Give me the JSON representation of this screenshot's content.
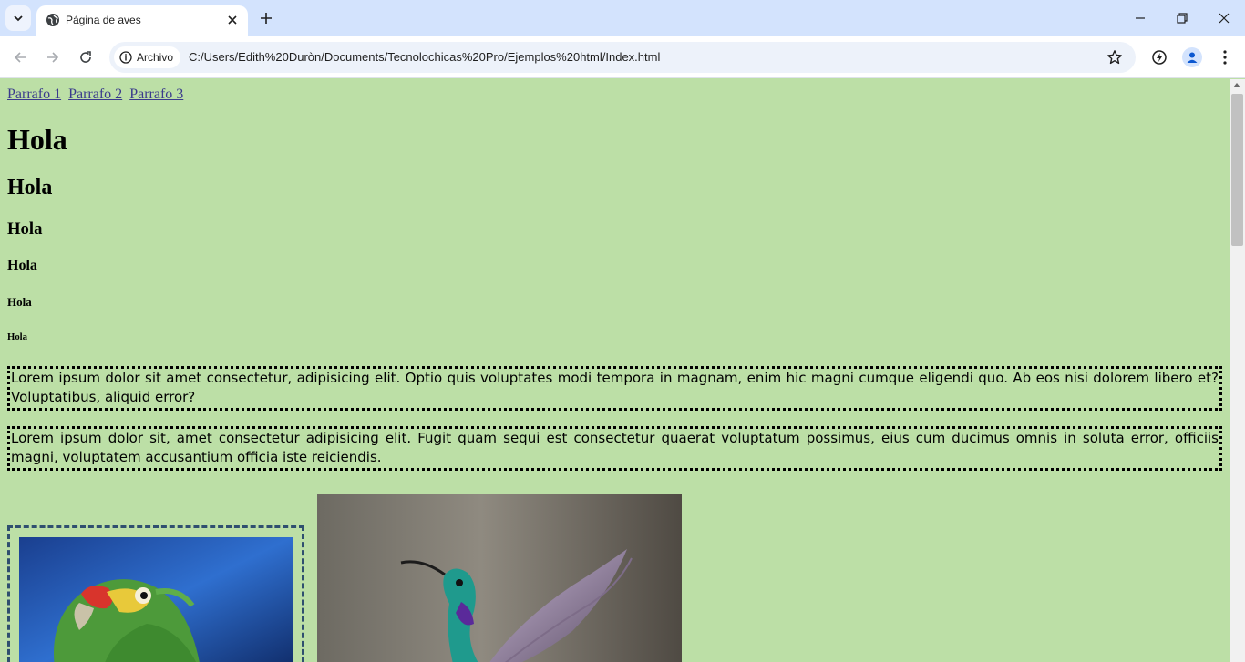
{
  "browser": {
    "tab_title": "Página de aves",
    "security_chip": "Archivo",
    "url": "C:/Users/Edith%20Duròn/Documents/Tecnolochicas%20Pro/Ejemplos%20html/Index.html"
  },
  "page": {
    "nav_links": [
      "Parrafo 1",
      "Parrafo 2",
      "Parrafo 3"
    ],
    "headings": {
      "h1": "Hola",
      "h2": "Hola",
      "h3": "Hola",
      "h4": "Hola",
      "h5": "Hola",
      "h6": "Hola"
    },
    "paragraphs": [
      "Lorem ipsum dolor sit amet consectetur, adipisicing elit. Optio quis voluptates modi tempora in magnam, enim hic magni cumque eligendi quo. Ab eos nisi dolorem libero et? Voluptatibus, aliquid error?",
      "Lorem ipsum dolor sit, amet consectetur adipisicing elit. Fugit quam sequi est consectetur quaerat voluptatum possimus, eius cum ducimus omnis in soluta error, officiis magni, voluptatem accusantium officia iste reiciendis."
    ]
  },
  "colors": {
    "page_background": "#bcdfa6",
    "tabstrip": "#d3e3fd",
    "link": "#3a3a8c"
  }
}
